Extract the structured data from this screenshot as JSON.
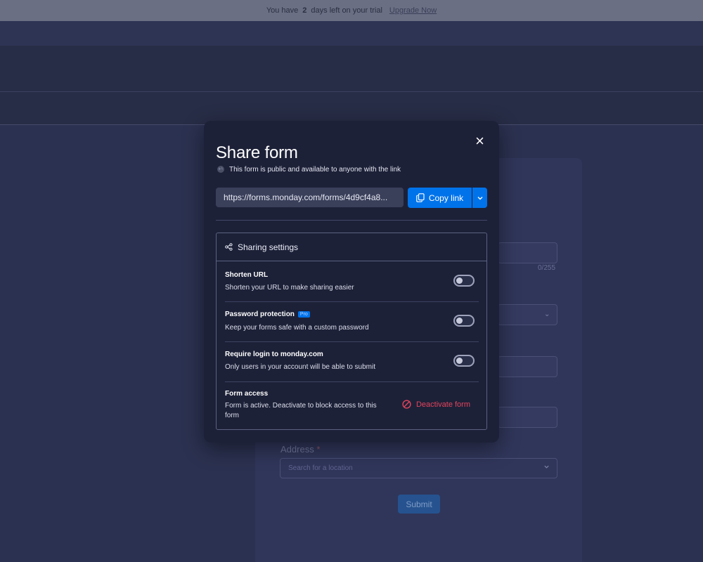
{
  "trial_banner": {
    "prefix": "You have",
    "days": "2",
    "suffix": "days left on your trial",
    "upgrade_label": "Upgrade Now"
  },
  "background_form": {
    "char_counter": "0/255",
    "address_label": "Address",
    "address_required_mark": "*",
    "address_placeholder": "Search for a location",
    "submit_label": "Submit"
  },
  "modal": {
    "title": "Share form",
    "subtitle": "This form is public and available to anyone with the link",
    "url": "https://forms.monday.com/forms/4d9cf4a8...",
    "copy_label": "Copy link",
    "settings": {
      "header": "Sharing settings",
      "rows": [
        {
          "title": "Shorten URL",
          "desc": "Shorten your URL to make sharing easier",
          "enabled": false
        },
        {
          "title": "Password protection",
          "badge": "Pro",
          "desc": "Keep your forms safe with a custom password",
          "enabled": false
        },
        {
          "title": "Require login to monday.com",
          "desc": "Only users in your account will be able to submit",
          "enabled": false
        }
      ],
      "access": {
        "title": "Form access",
        "desc": "Form is active. Deactivate to block access to this form",
        "action": "Deactivate form"
      }
    }
  },
  "colors": {
    "primary": "#0073ea",
    "danger": "#e2445c",
    "modal_bg": "#1d2138"
  }
}
